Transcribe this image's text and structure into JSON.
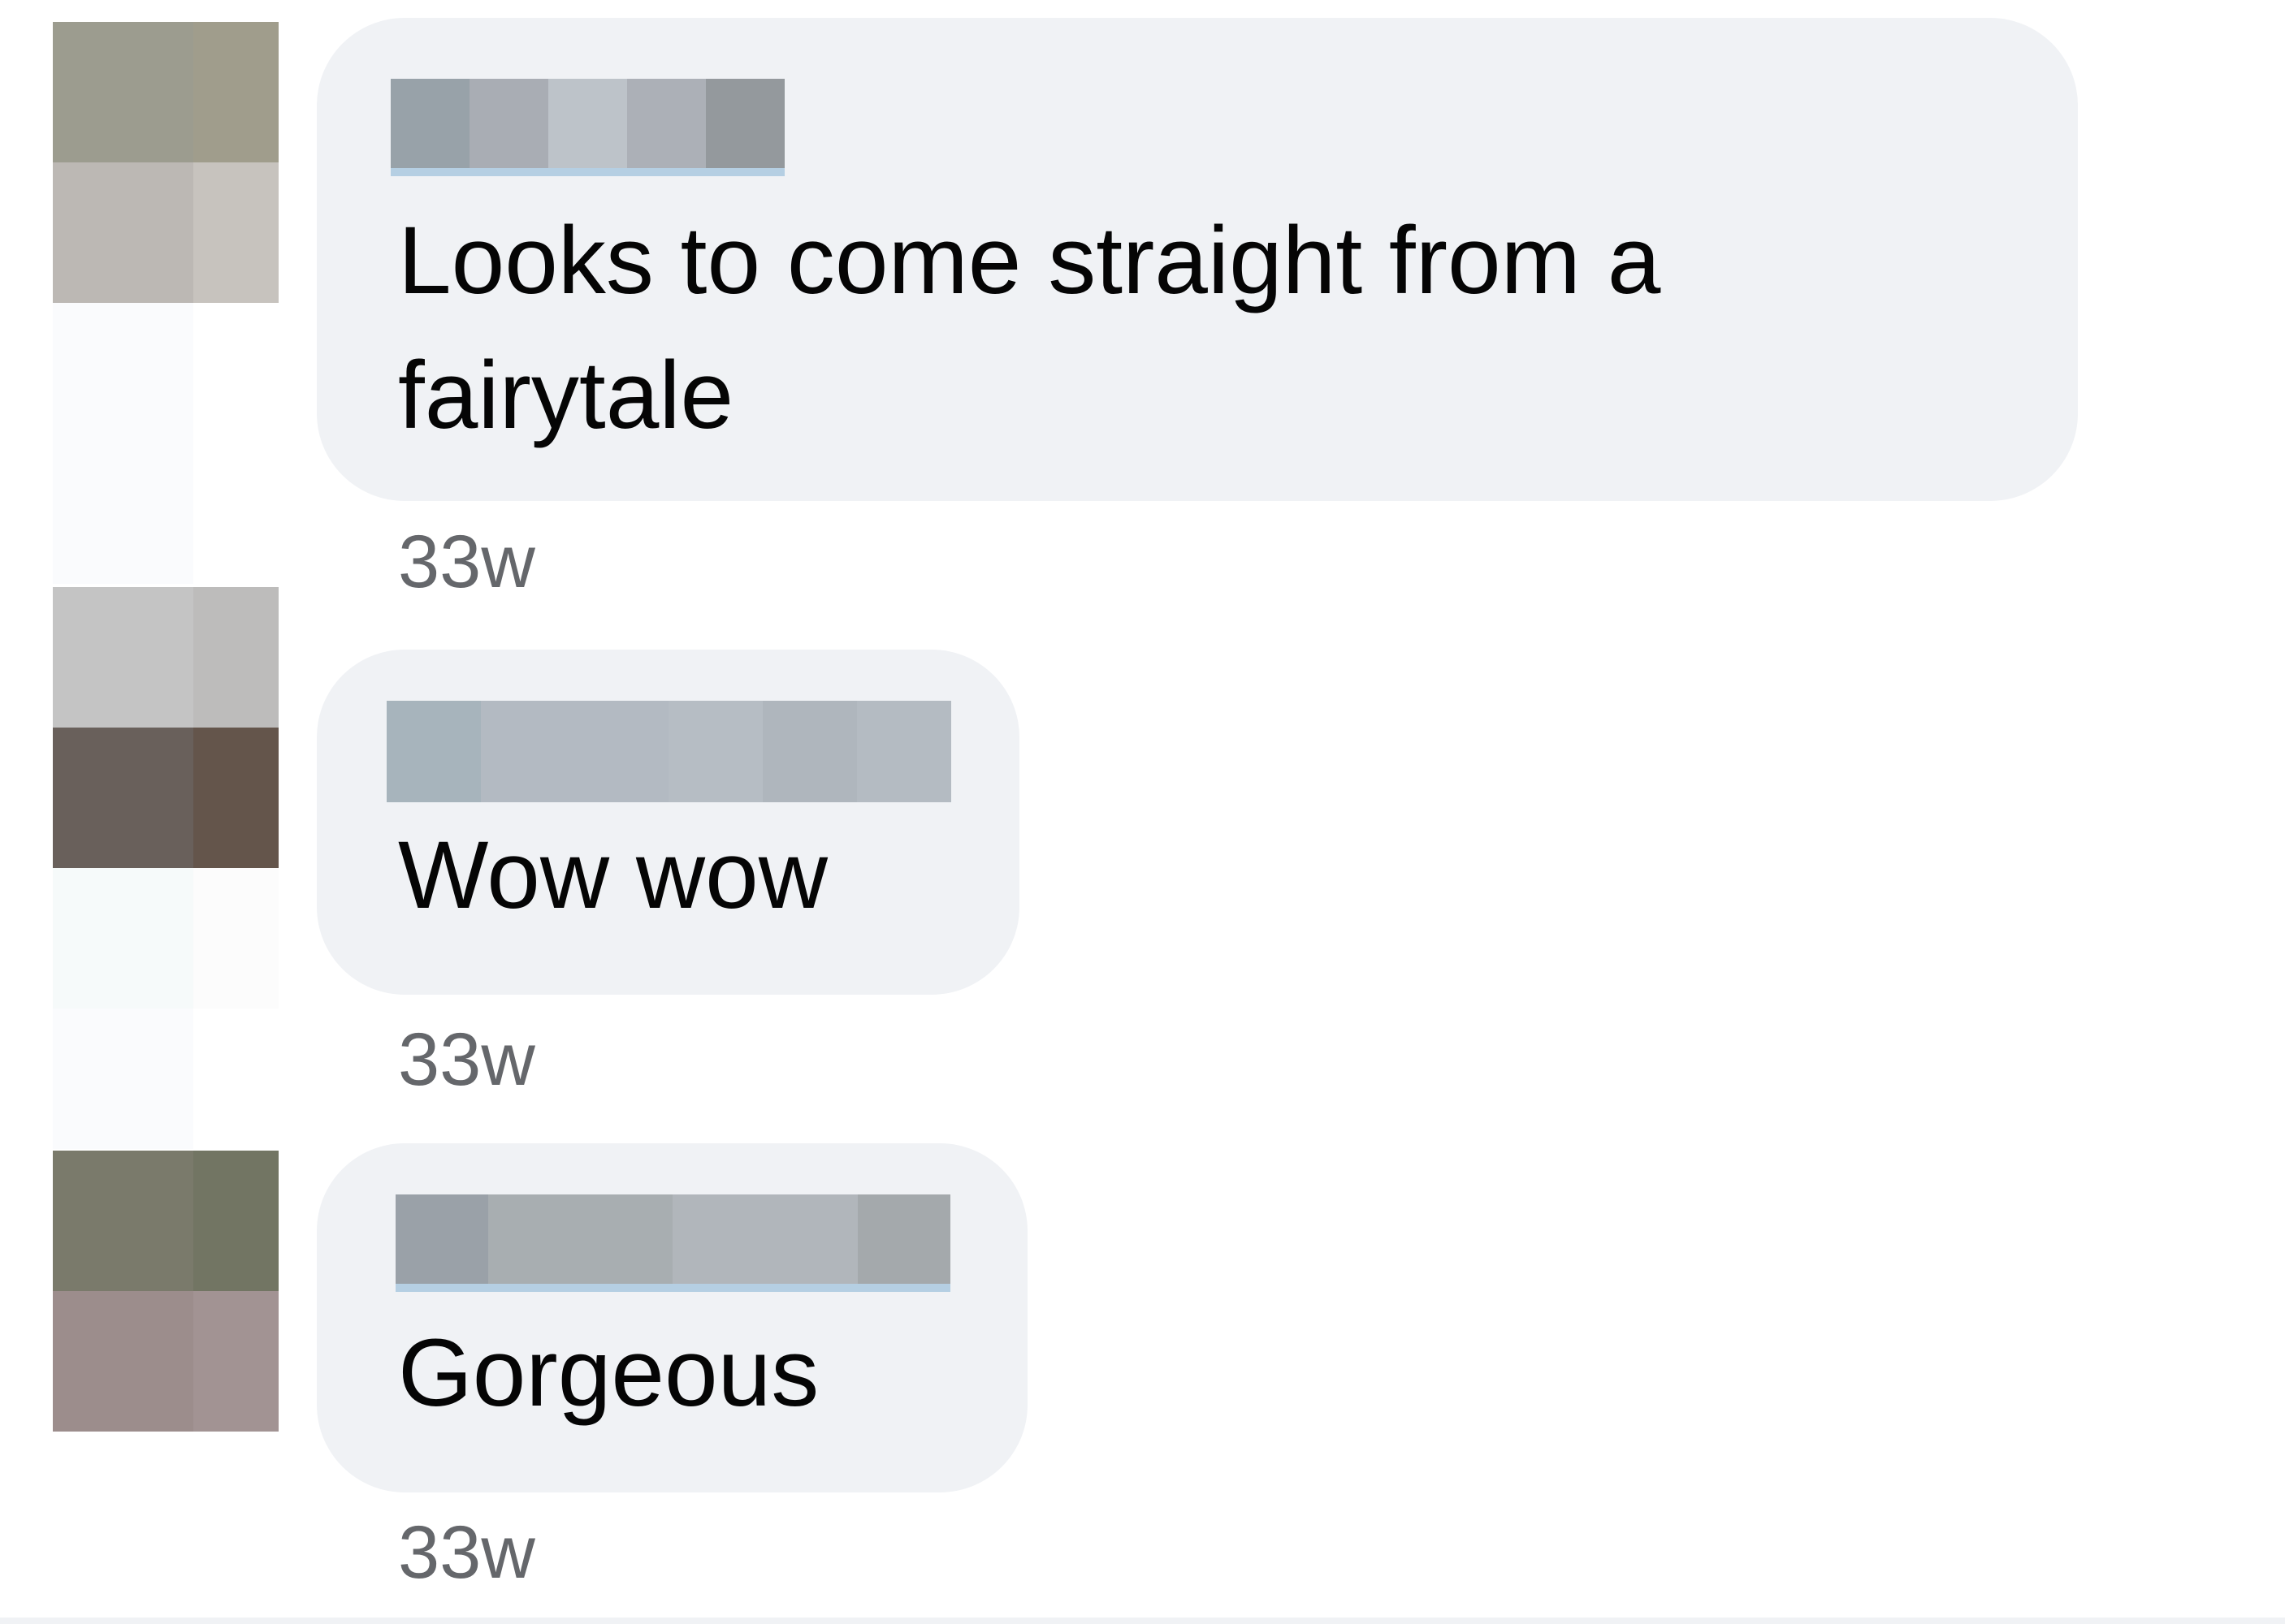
{
  "comments": [
    {
      "text": "Looks to come straight from a fairytale",
      "timestamp": "33w",
      "author_redacted": true,
      "avatar_colors": [
        "#9c9c8f",
        "#a09d8c",
        "#bcb8b4",
        "#c7c3be",
        "#fafbfd",
        "#ffffff",
        "#fafbfd",
        "#ffffff"
      ],
      "author_colors": [
        "#98a2a9",
        "#a9adb4",
        "#bdc3c9",
        "#acb0b7",
        "#94999d"
      ]
    },
    {
      "text": "Wow wow",
      "timestamp": "33w",
      "author_redacted": true,
      "avatar_colors": [
        "#c4c4c4",
        "#bdbcbb",
        "#69605b",
        "#64554b",
        "#f6fafa",
        "#fcfcfc",
        "#fafbfd",
        "#ffffff"
      ],
      "author_colors": [
        "#a7b4bc",
        "#b3bac2",
        "#b3bac2",
        "#b6bdc4",
        "#afb6bd",
        "#b4bbc2"
      ]
    },
    {
      "text": "Gorgeous",
      "timestamp": "33w",
      "author_redacted": true,
      "avatar_colors": [
        "#7a7a6b",
        "#727563",
        "#9c8d8c",
        "#a29393"
      ],
      "author_colors": [
        "#9aa1a8",
        "#a8aeb1",
        "#a8aeb1",
        "#b1b6bb",
        "#b1b6bb",
        "#a4a9ac"
      ]
    }
  ],
  "colors": {
    "bubble_background": "#f0f2f5",
    "text": "#050505",
    "timestamp": "#65676b",
    "author_underline": "#b5cfe3"
  }
}
